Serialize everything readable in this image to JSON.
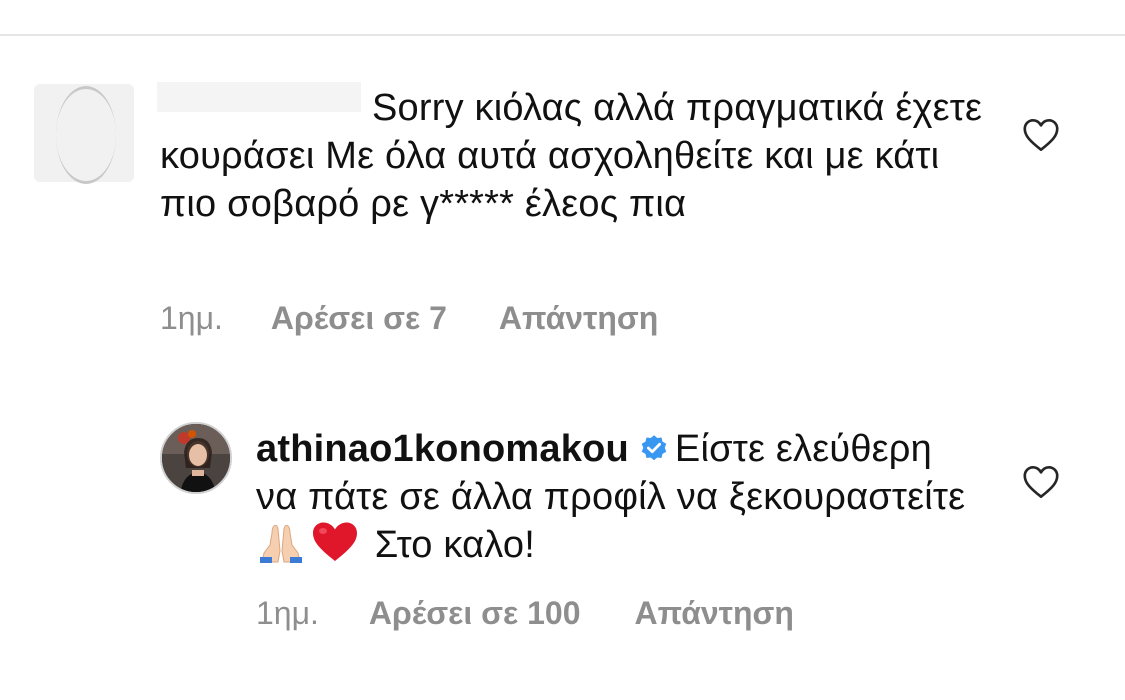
{
  "comments": [
    {
      "username": "",
      "text_lines": [
        "Sorry κιόλας αλλά",
        "πραγματικά έχετε κουράσει Με όλα αυτά",
        "ασχοληθείτε και με κάτι πιο σοβαρό ρε",
        "γ***** έλεος πια"
      ],
      "time": "1ημ.",
      "likes_label": "Αρέσει σε 7",
      "reply_label": "Απάντηση",
      "avatar": "blank-avatar",
      "verified": false
    },
    {
      "username": "athinao1konomakou",
      "text_before_emoji": "Είστε ελεύθερη να πάτε σε άλλα προφίλ να ξεκουραστείτε",
      "emojis": [
        "folded-hands-icon",
        "red-heart-icon"
      ],
      "text_after_emoji": "Στο καλο!",
      "time": "1ημ.",
      "likes_label": "Αρέσει σε 100",
      "reply_label": "Απάντηση",
      "avatar": "profile-photo",
      "verified": true
    }
  ],
  "icons": {
    "like": "heart-outline-icon",
    "verified": "verified-badge-icon"
  },
  "colors": {
    "text": "#111111",
    "meta": "#8e8e8e",
    "verified_blue": "#3897f0",
    "heart_red": "#e0162b",
    "divider": "#e6e6e6"
  }
}
